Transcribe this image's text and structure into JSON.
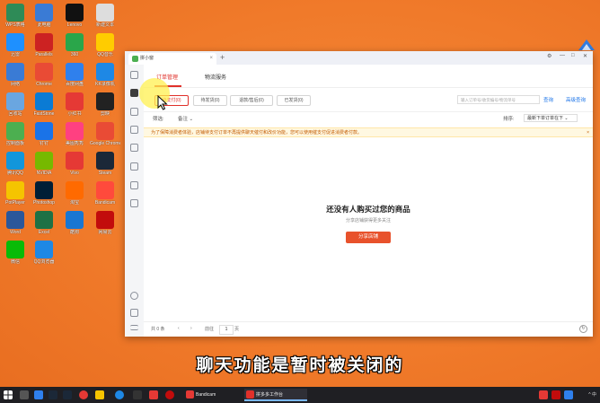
{
  "desktop": {
    "icons": [
      {
        "label": "WPS表格",
        "color": "#2e8b57"
      },
      {
        "label": "此电脑",
        "color": "#3a7bd5"
      },
      {
        "label": "Lenovo",
        "color": "#111111"
      },
      {
        "label": "新建文本",
        "color": "#dddddd"
      },
      {
        "label": "迅雷",
        "color": "#1e90ff"
      },
      {
        "label": "Parallels",
        "color": "#cc2222"
      },
      {
        "label": "360",
        "color": "#2aa64a"
      },
      {
        "label": "QQ音乐",
        "color": "#ffcc00"
      },
      {
        "label": "网络",
        "color": "#3a7bd5"
      },
      {
        "label": "Chrome",
        "color": "#e94b35"
      },
      {
        "label": "百度网盘",
        "color": "#2f80ed"
      },
      {
        "label": "KK录像机",
        "color": "#1e88e5"
      },
      {
        "label": "回收站",
        "color": "#6aa6e0"
      },
      {
        "label": "FastStone",
        "color": "#0b7bd4"
      },
      {
        "label": "小红书",
        "color": "#e53935"
      },
      {
        "label": "剪映",
        "color": "#222222"
      },
      {
        "label": "控制面板",
        "color": "#4caf50"
      },
      {
        "label": "钉钉",
        "color": "#1a73e8"
      },
      {
        "label": "美图秀秀",
        "color": "#ff4081"
      },
      {
        "label": "Google Chrome",
        "color": "#e94b35"
      },
      {
        "label": "腾讯QQ",
        "color": "#1296db"
      },
      {
        "label": "NVIDIA",
        "color": "#76b900"
      },
      {
        "label": "Vivo",
        "color": "#e53935"
      },
      {
        "label": "Steam",
        "color": "#1b2838"
      },
      {
        "label": "PotPlayer",
        "color": "#f5c400"
      },
      {
        "label": "Photoshop",
        "color": "#001e36"
      },
      {
        "label": "淘宝",
        "color": "#ff6a00"
      },
      {
        "label": "Bandicam",
        "color": "#ff4a3c"
      },
      {
        "label": "Word",
        "color": "#2b579a"
      },
      {
        "label": "Excel",
        "color": "#1e7145"
      },
      {
        "label": "酷狗",
        "color": "#1976d2"
      },
      {
        "label": "网易云",
        "color": "#c20c0c"
      },
      {
        "label": "微信",
        "color": "#09bb07"
      },
      {
        "label": "QQ浏览器",
        "color": "#1e88e5"
      }
    ]
  },
  "window": {
    "tab_title": "拼小窗",
    "tab_close": "×",
    "tab_add": "+",
    "controls": [
      "⚙",
      "—",
      "□",
      "✕"
    ],
    "subtabs": [
      {
        "label": "订单管理",
        "active": true
      },
      {
        "label": "物流服务",
        "active": false
      }
    ],
    "filters": [
      {
        "label": "待支付(0)",
        "active": true
      },
      {
        "label": "待发货(0)",
        "active": false
      },
      {
        "label": "退款/售后(0)",
        "active": false
      },
      {
        "label": "已发货(0)",
        "active": false
      }
    ],
    "search_placeholder": "输入订单号/收货编号/物流单号",
    "search_button": "查询",
    "advanced_button": "高级查询",
    "filter_label": "筛选:",
    "filter_value": "备注 ⌄",
    "sort_label": "排序:",
    "sort_value": "最新下单订单在下 ⌄",
    "notice": "为了保障消费者体验，店铺待支付订单不再提供聊天催付和改价功能，您可以使用催支付促进消费者付款。",
    "notice_close": "×",
    "empty_title": "还没有人购买过您的商品",
    "empty_subtitle": "分享店铺获得更多关注",
    "empty_button": "分享店铺",
    "pager": {
      "total": "共 0 条",
      "prev": "‹",
      "next": "›",
      "goto_label": "前往",
      "page_value": "1",
      "page_unit": "页"
    },
    "refresh": "↻"
  },
  "subtitle": "聊天功能是暂时被关闭的",
  "taskbar": {
    "apps": [
      {
        "label": "Bandicam",
        "color": "#e53935"
      },
      {
        "label": "拼多多工作台",
        "color": "#e0302a"
      }
    ],
    "tray_text": "^ 中"
  }
}
